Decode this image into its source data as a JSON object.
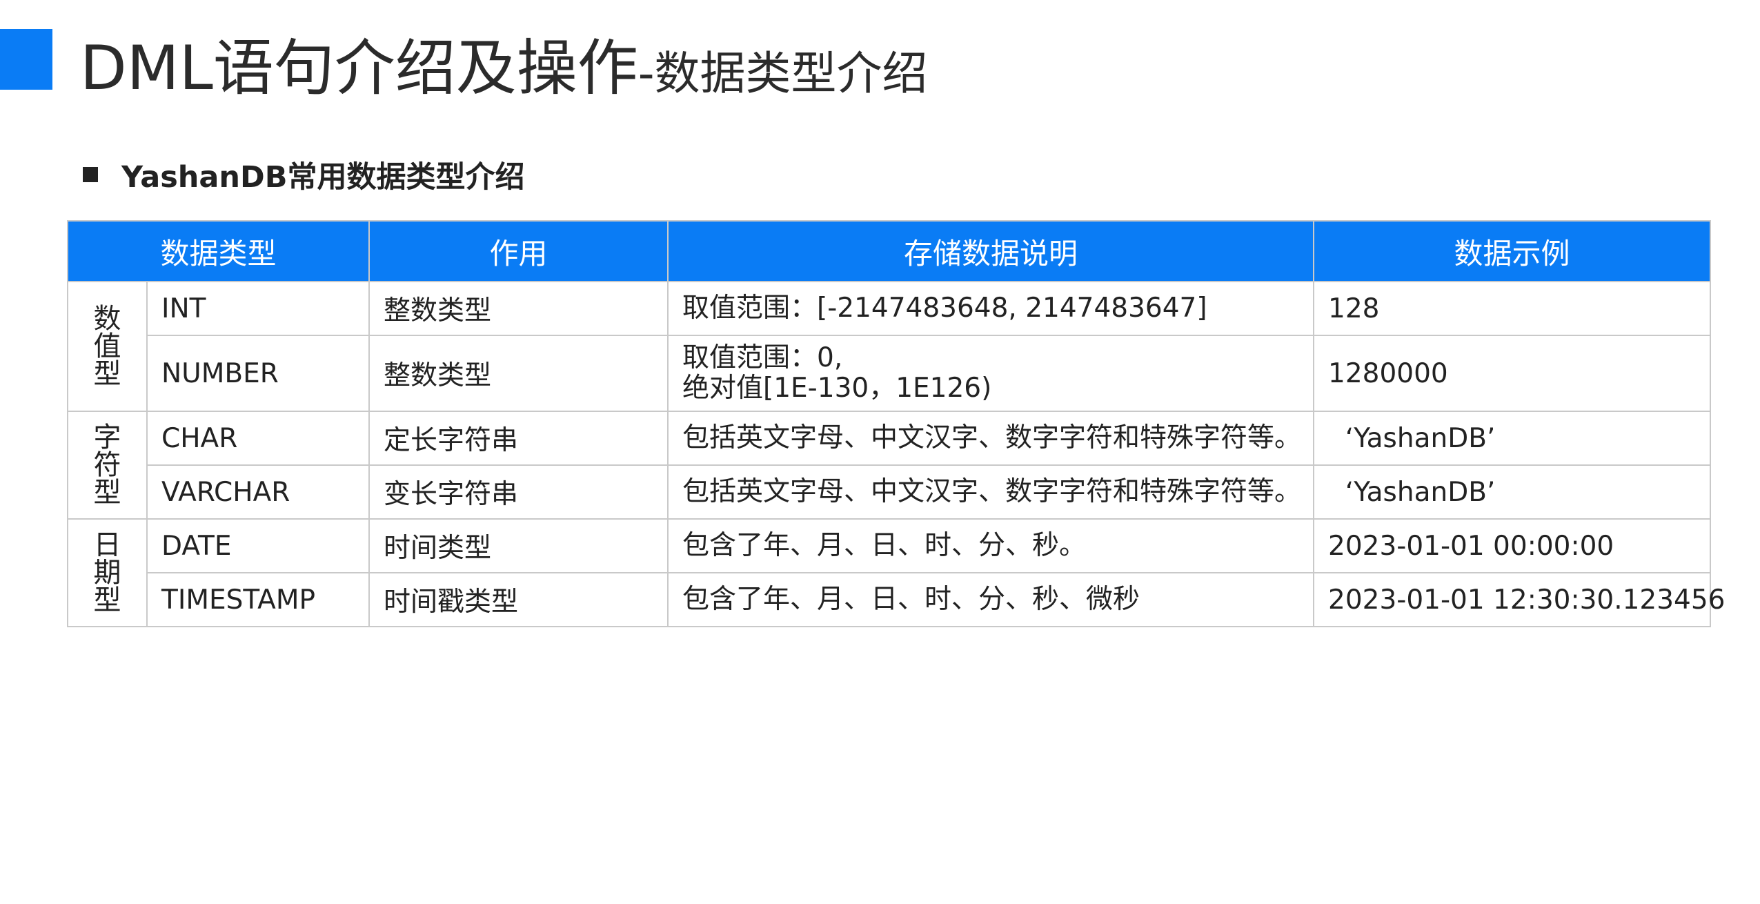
{
  "slide": {
    "title_main": "DML语句介绍及操作",
    "title_sub": "-数据类型介绍",
    "accent_color": "#0A7CF5"
  },
  "section": {
    "heading": "YashanDB常用数据类型介绍"
  },
  "table": {
    "headers": [
      "数据类型",
      "作用",
      "存储数据说明",
      "数据示例"
    ],
    "header_bg": "#0A7CF5",
    "groups": [
      {
        "label_chars": [
          "数",
          "值",
          "型"
        ],
        "rows": [
          {
            "type": "INT",
            "purpose": "整数类型",
            "desc": [
              "取值范围：[-2147483648, 2147483647]"
            ],
            "example": "128"
          },
          {
            "type": "NUMBER",
            "purpose": "整数类型",
            "desc": [
              "取值范围：0,",
              "绝对值[1E-130，1E126)"
            ],
            "example": "1280000"
          }
        ]
      },
      {
        "label_chars": [
          "字",
          "符",
          "型"
        ],
        "rows": [
          {
            "type": "CHAR",
            "purpose": "定长字符串",
            "desc": [
              "包括英文字母、中文汉字、数字字符和特殊字符等。"
            ],
            "example": "  ‘YashanDB’"
          },
          {
            "type": "VARCHAR",
            "purpose": "变长字符串",
            "desc": [
              "包括英文字母、中文汉字、数字字符和特殊字符等。"
            ],
            "example": "  ‘YashanDB’"
          }
        ]
      },
      {
        "label_chars": [
          "日",
          "期",
          "型"
        ],
        "rows": [
          {
            "type": "DATE",
            "purpose": "时间类型",
            "desc": [
              "包含了年、月、日、时、分、秒。"
            ],
            "example": "2023-01-01 00:00:00"
          },
          {
            "type": "TIMESTAMP",
            "purpose": "时间戳类型",
            "desc": [
              "包含了年、月、日、时、分、秒、微秒"
            ],
            "example": "2023-01-01 12:30:30.123456"
          }
        ]
      }
    ]
  }
}
